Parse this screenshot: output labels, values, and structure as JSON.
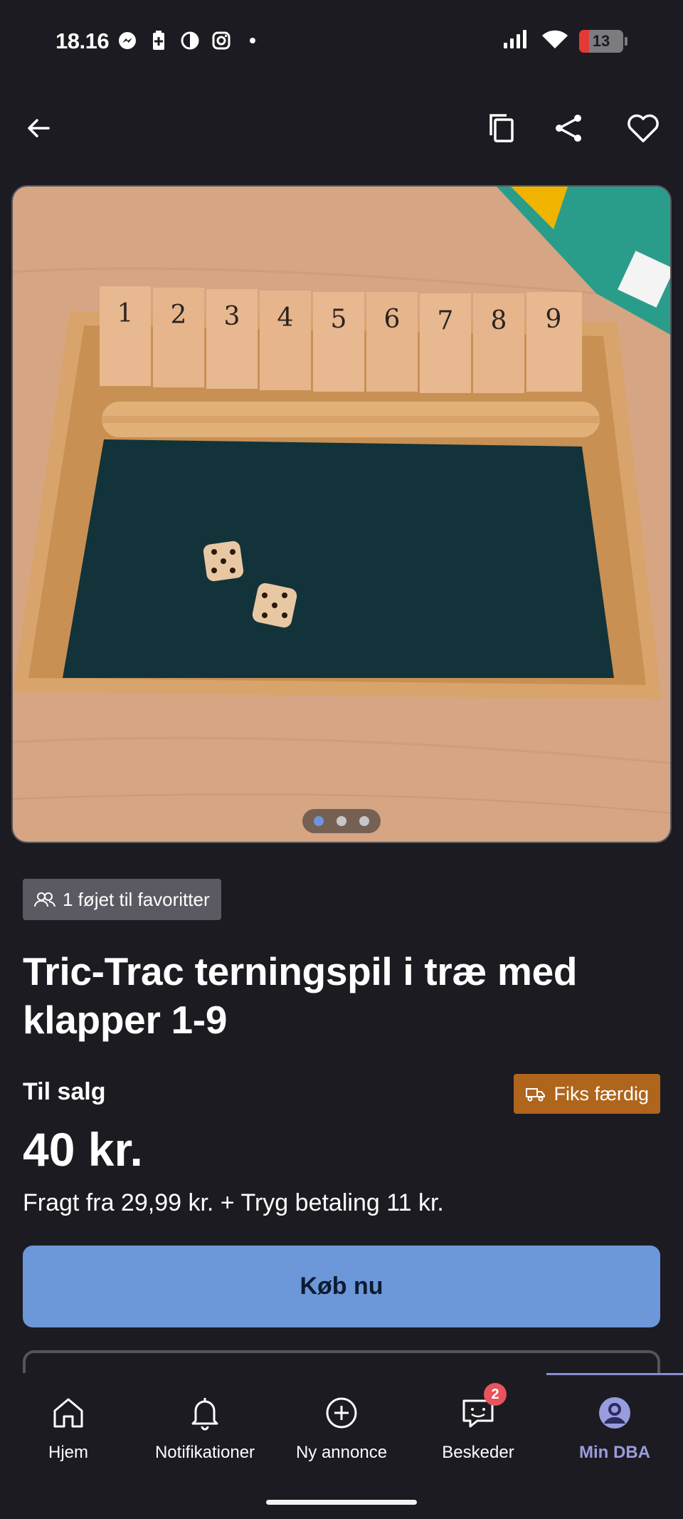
{
  "status_bar": {
    "time": "18.16",
    "battery": "13"
  },
  "listing": {
    "image_pager": {
      "count": 3,
      "active_index": 0
    },
    "favorites_chip": "1 føjet til favoritter",
    "title": "Tric-Trac terningspil i træ med klapper 1-9",
    "sale_type": "Til salg",
    "badge_fiks": "Fiks færdig",
    "price": "40 kr.",
    "shipping": "Fragt fra 29,99 kr. + Tryg betaling 11 kr.",
    "buy_label": "Køb nu"
  },
  "nav": {
    "items": [
      {
        "label": "Hjem",
        "icon": "home-icon"
      },
      {
        "label": "Notifikationer",
        "icon": "bell-icon"
      },
      {
        "label": "Ny annonce",
        "icon": "plus-circle-icon"
      },
      {
        "label": "Beskeder",
        "icon": "chat-icon",
        "badge": "2"
      },
      {
        "label": "Min DBA",
        "icon": "profile-icon",
        "active": true
      }
    ]
  },
  "colors": {
    "background": "#1c1b21",
    "buy_button": "#6c97d9",
    "fiks_badge": "#b0651c",
    "active_nav": "#9a9ce0",
    "badge": "#e8545e"
  }
}
